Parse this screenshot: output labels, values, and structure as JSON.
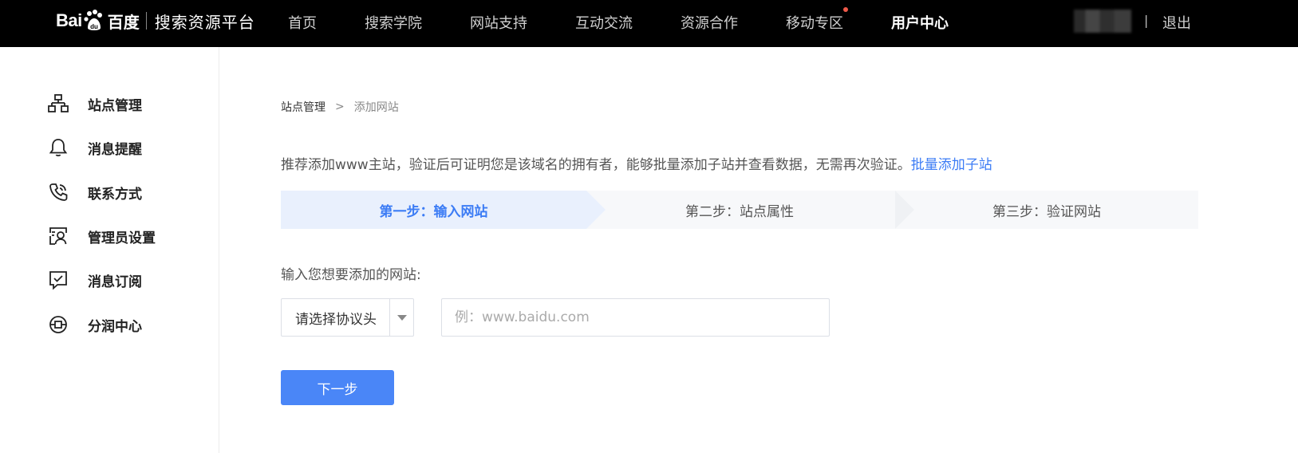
{
  "header": {
    "logo_text_latin": "Bai",
    "logo_text_du": "du",
    "logo_text_cn": "百度",
    "platform_name": "搜索资源平台",
    "nav": [
      {
        "label": "首页",
        "active": false
      },
      {
        "label": "搜索学院",
        "active": false
      },
      {
        "label": "网站支持",
        "active": false
      },
      {
        "label": "互动交流",
        "active": false
      },
      {
        "label": "资源合作",
        "active": false
      },
      {
        "label": "移动专区",
        "active": false,
        "badge_dot": true
      },
      {
        "label": "用户中心",
        "active": true
      }
    ],
    "divider": "|",
    "logout_label": "退出"
  },
  "sidebar": {
    "items": [
      {
        "label": "站点管理",
        "icon": "sitemap-icon"
      },
      {
        "label": "消息提醒",
        "icon": "bell-icon"
      },
      {
        "label": "联系方式",
        "icon": "phone-icon"
      },
      {
        "label": "管理员设置",
        "icon": "admin-user-icon"
      },
      {
        "label": "消息订阅",
        "icon": "subscribe-chat-icon"
      },
      {
        "label": "分润中心",
        "icon": "coin-icon"
      }
    ]
  },
  "breadcrumb": {
    "root": "站点管理",
    "separator": ">",
    "current": "添加网站"
  },
  "tip": {
    "text": "推荐添加www主站，验证后可证明您是该域名的拥有者，能够批量添加子站并查看数据，无需再次验证。",
    "link": "批量添加子站"
  },
  "steps": [
    {
      "label": "第一步：输入网站",
      "active": true
    },
    {
      "label": "第二步：站点属性",
      "active": false
    },
    {
      "label": "第三步：验证网站",
      "active": false
    }
  ],
  "form": {
    "site_label": "输入您想要添加的网站:",
    "protocol_placeholder": "请选择协议头",
    "url_placeholder": "例：www.baidu.com",
    "url_value": "",
    "next_label": "下一步"
  },
  "colors": {
    "accent": "#3c7cf5",
    "button": "#4a86f7",
    "topbar": "#000000",
    "active_step_bg": "#e9f0fd"
  }
}
